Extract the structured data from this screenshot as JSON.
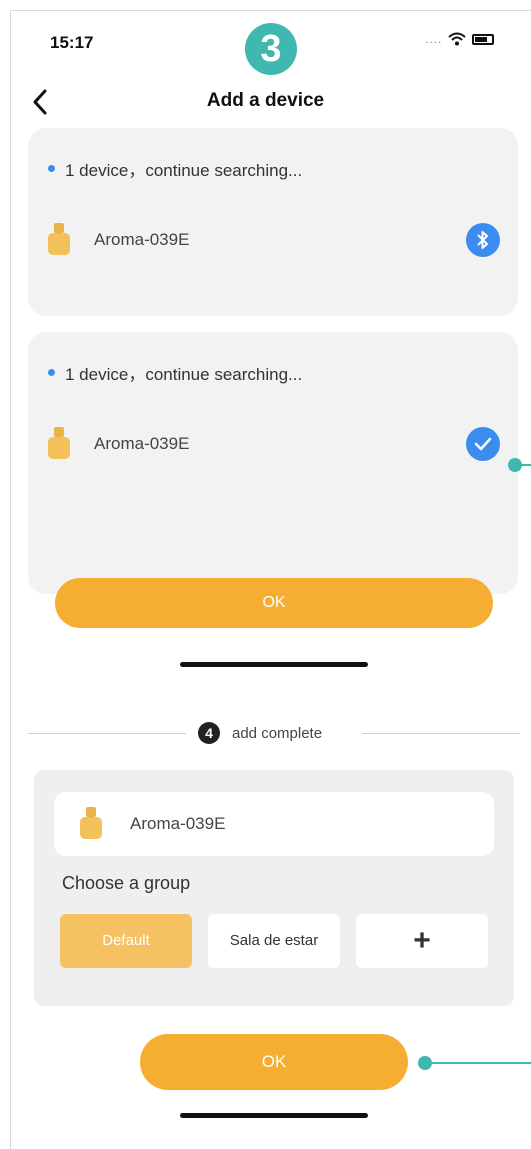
{
  "status_bar": {
    "time": "15:17",
    "dots": "....",
    "step_number": "3"
  },
  "nav": {
    "title": "Add a device"
  },
  "scan_card_1": {
    "status": "1 device，continue searching...",
    "device_name": "Aroma-039E",
    "action_icon": "bluetooth-icon"
  },
  "scan_card_2": {
    "status": "1 device，continue searching...",
    "device_name": "Aroma-039E",
    "action_icon": "checkmark-icon"
  },
  "confirm_button": {
    "label": "OK"
  },
  "step4": {
    "number": "4",
    "label": "add complete"
  },
  "complete_card": {
    "device_name": "Aroma-039E",
    "group_label": "Choose a group",
    "groups": [
      "Default",
      "Sala de estar",
      "+"
    ],
    "selected_group": "Default"
  },
  "finish_button": {
    "label": "OK"
  },
  "colors": {
    "accent": "#f5ae32",
    "blue": "#3c8cf0",
    "teal": "#3fb8b0"
  }
}
